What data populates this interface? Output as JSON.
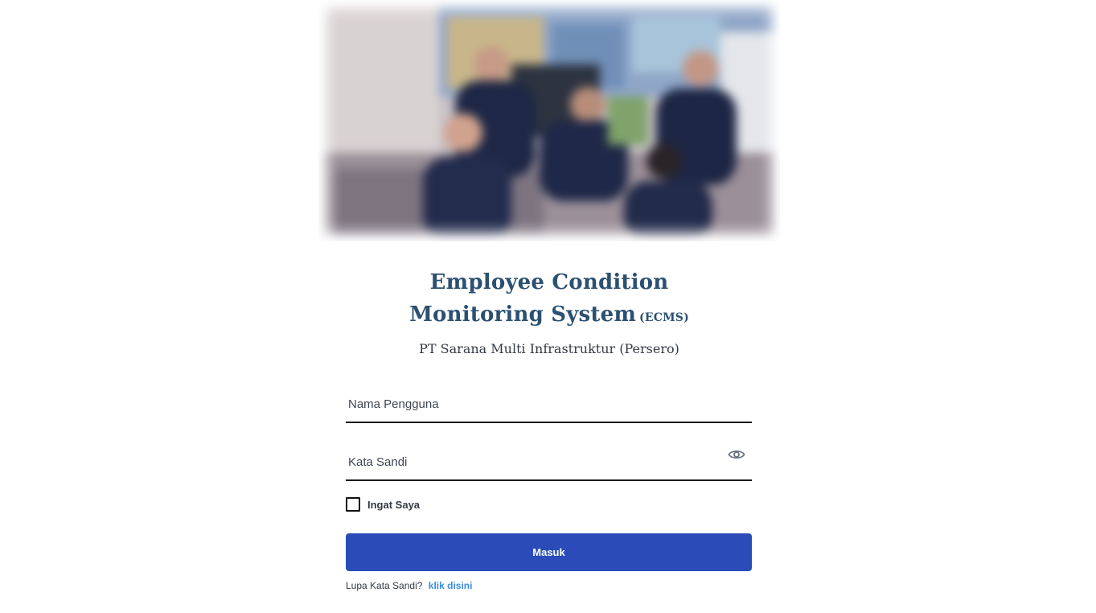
{
  "header": {
    "title_line1": "Employee Condition",
    "title_line2": "Monitoring System",
    "title_abbr": "(ECMS)",
    "company": "PT Sarana Multi Infrastruktur (Persero)"
  },
  "form": {
    "username_placeholder": "Nama Pengguna",
    "username_value": "",
    "password_placeholder": "Kata Sandi",
    "password_value": "",
    "remember_label": "Ingat Saya",
    "remember_checked": false,
    "submit_label": "Masuk",
    "forgot_text": "Lupa Kata Sandi?",
    "forgot_link": "klik disini"
  },
  "icons": {
    "password_toggle": "eye-icon"
  },
  "colors": {
    "title": "#2c5072",
    "button": "#2a4bb8",
    "link": "#3a8ee0",
    "field_border": "#1a1a1a"
  }
}
